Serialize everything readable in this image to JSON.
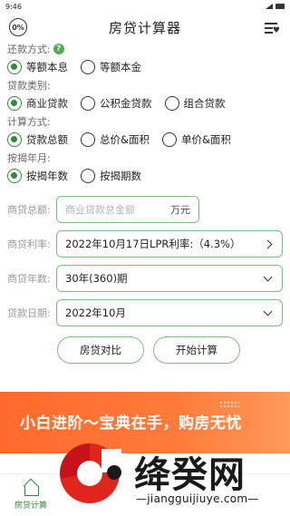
{
  "status_bar": {
    "time": "9:46"
  },
  "app_bar": {
    "logo_text": "0%",
    "title": "房贷计算器",
    "menu_icon": "list-heart-icon"
  },
  "repayment": {
    "label": "还款方式:",
    "help_text": "?",
    "options": [
      {
        "label": "等额本息",
        "selected": true
      },
      {
        "label": "等额本金",
        "selected": false
      }
    ]
  },
  "loan_type": {
    "label": "贷款类别:",
    "options": [
      {
        "label": "商业贷款",
        "selected": true
      },
      {
        "label": "公积金贷款",
        "selected": false
      },
      {
        "label": "组合贷款",
        "selected": false
      }
    ]
  },
  "calc_method": {
    "label": "计算方式:",
    "options": [
      {
        "label": "贷款总额",
        "selected": true
      },
      {
        "label": "总价&面积",
        "selected": false
      },
      {
        "label": "单价&面积",
        "selected": false
      }
    ]
  },
  "mortgage_term_type": {
    "label": "按揭年月:",
    "options": [
      {
        "label": "按揭年数",
        "selected": true
      },
      {
        "label": "按揭期数",
        "selected": false
      }
    ]
  },
  "form": {
    "loan_total_label": "商贷总额:",
    "loan_total_placeholder": "商业贷款总金额",
    "loan_total_unit": "万元",
    "rate_label": "商贷利率:",
    "rate_value": "2022年10月17日LPR利率:（4.3%）",
    "years_label": "商贷年数:",
    "years_value": "30年(360)期",
    "date_label": "贷款日期:",
    "date_value": "2022年10月"
  },
  "buttons": {
    "compare": "房贷对比",
    "calculate": "开始计算"
  },
  "banner": {
    "text": "小白进阶～宝典在手，购房无忧"
  },
  "tab_bar": {
    "tab_label": "房贷计算"
  },
  "watermark": {
    "title": "绛癸网",
    "url": "—jiangguijiuye.com—"
  },
  "colors": {
    "accent": "#2e8b3a",
    "border": "#7cbf7c",
    "banner": "#ff6a2a"
  }
}
